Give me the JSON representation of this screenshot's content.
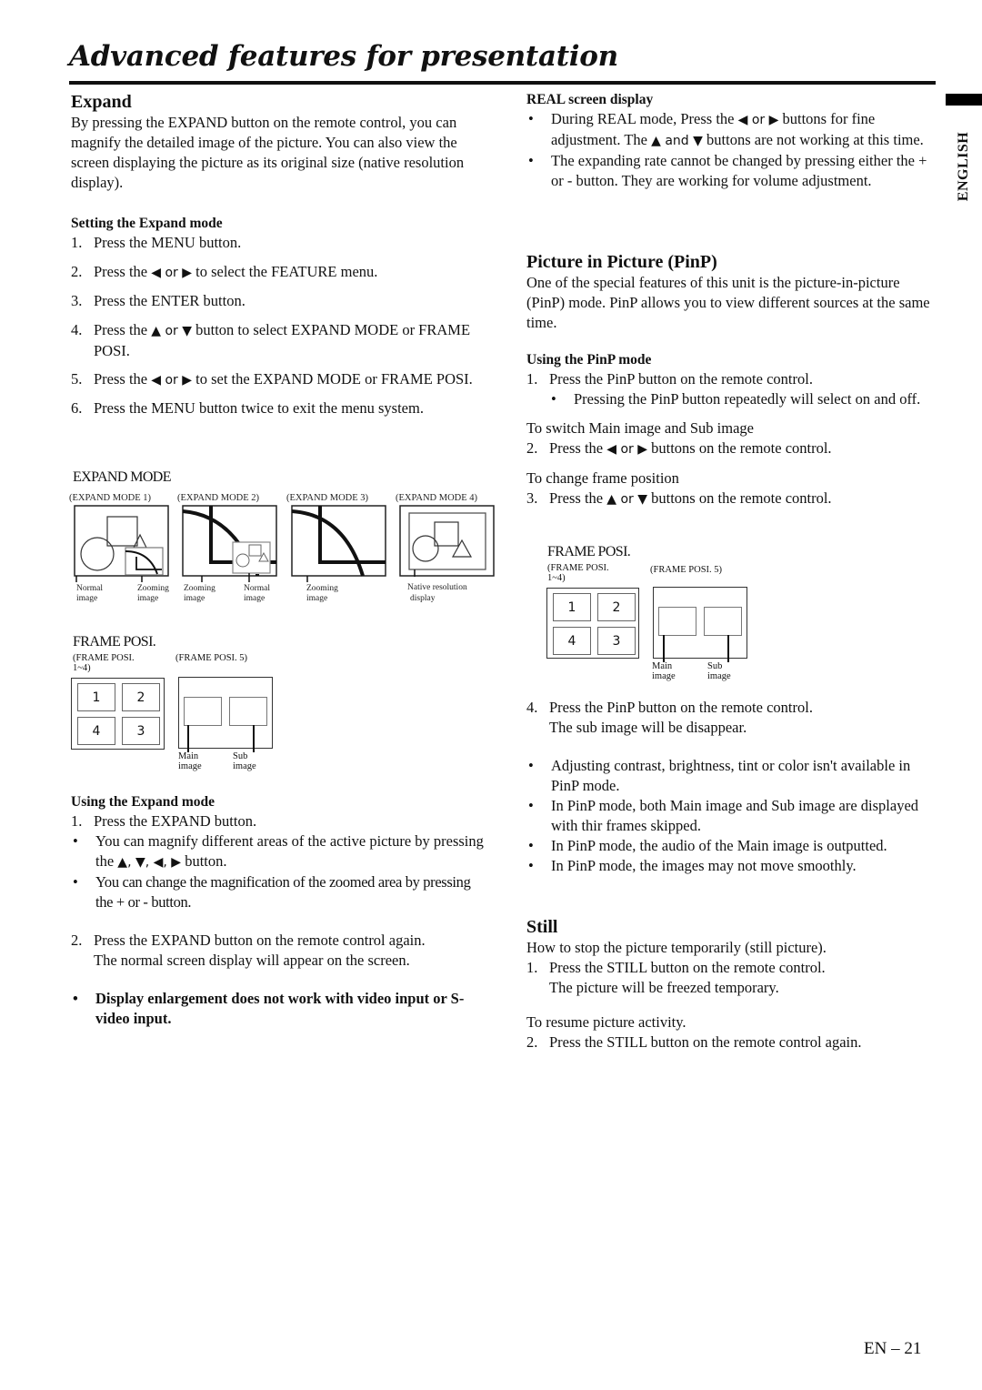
{
  "page": {
    "title": "Advanced features for presentation",
    "language_tab": "ENGLISH",
    "page_number": "EN – 21"
  },
  "expand": {
    "heading": "Expand",
    "intro": "By pressing the EXPAND button on the remote control, you can magnify the detailed image of the picture. You can also view the screen displaying the picture as its original size (native resolution display).",
    "setting": {
      "heading": "Setting the Expand mode",
      "steps": [
        {
          "n": "1.",
          "pre": "Press the MENU button.",
          "icons": "",
          "post": ""
        },
        {
          "n": "2.",
          "pre": "Press the ",
          "icons": "◀ or ▶",
          "post": " to select the FEATURE menu."
        },
        {
          "n": "3.",
          "pre": "Press the ENTER button.",
          "icons": "",
          "post": ""
        },
        {
          "n": "4.",
          "pre": "Press the ",
          "icons": "▲ or ▼",
          "post": " button to select EXPAND MODE or FRAME POSI."
        },
        {
          "n": "5.",
          "pre": "Press the ",
          "icons": "◀ or ▶",
          "post": " to set the EXPAND MODE or FRAME POSI."
        },
        {
          "n": "6.",
          "pre": "Press the MENU button twice to exit the menu system.",
          "icons": "",
          "post": ""
        }
      ]
    },
    "expand_mode_diagram": {
      "heading": "EXPAND MODE",
      "modes": [
        {
          "label": "(EXPAND MODE 1)",
          "callouts": [
            "Normal image",
            "Zooming image"
          ]
        },
        {
          "label": "(EXPAND MODE 2)",
          "callouts": [
            "Zooming image",
            "Normal image"
          ]
        },
        {
          "label": "(EXPAND MODE 3)",
          "callouts": [
            "Zooming image"
          ]
        },
        {
          "label": "(EXPAND MODE 4)",
          "callouts": [
            "Native resolution display"
          ]
        }
      ]
    },
    "frame_posi_diagram": {
      "heading": "FRAME POSI.",
      "label_1_4": "(FRAME POSI. 1~4)",
      "label_5": "(FRAME POSI. 5)",
      "cells": [
        "1",
        "2",
        "4",
        "3"
      ],
      "main_label": "Main image",
      "sub_label": "Sub image"
    },
    "using": {
      "heading": "Using the Expand mode",
      "step1": {
        "n": "1.",
        "text": "Press the EXPAND button."
      },
      "bullet1": {
        "pre": "You can magnify different areas of the active picture by pressing the ",
        "icons": "▲, ▼, ◀, ▶",
        "post": " button."
      },
      "bullet2": "You can change the magnification of the zoomed area by pressing the + or - button.",
      "step2": {
        "n": "2.",
        "text": "Press the EXPAND button on the remote control again.",
        "note": "The normal screen display will appear on the screen."
      },
      "warning": "Display enlargement does not work with video input or S-video input."
    }
  },
  "real_screen": {
    "heading": "REAL screen display",
    "bullet1": {
      "pre": "During REAL mode, Press the ",
      "icons1": "◀ or ▶",
      "mid": " buttons for fine adjustment. The ",
      "icons2": "▲ and ▼",
      "post": " buttons are not working at this time."
    },
    "bullet2": "The expanding rate cannot be changed by pressing either the + or - button. They are working for volume adjustment."
  },
  "pinp": {
    "heading": "Picture in Picture (PinP)",
    "intro": "One of the special features of this unit is the picture-in-picture (PinP) mode. PinP allows you to view different sources at the same time.",
    "using_heading": "Using the PinP mode",
    "step1": {
      "n": "1.",
      "text": "Press the PinP button on the remote control."
    },
    "step1_bullet": "Pressing the PinP button repeatedly will select on and off.",
    "switch_caption": "To switch Main image and Sub image",
    "step2": {
      "n": "2.",
      "pre": "Press the ",
      "icons": "◀ or ▶",
      "post": " buttons on the remote control."
    },
    "frame_caption": "To change frame position",
    "step3": {
      "n": "3.",
      "pre": "Press the ",
      "icons": "▲ or ▼",
      "post": " buttons on the remote control."
    },
    "frame_posi_diagram": {
      "heading": "FRAME POSI.",
      "label_1_4": "(FRAME POSI. 1~4)",
      "label_5": "(FRAME POSI. 5)",
      "cells": [
        "1",
        "2",
        "4",
        "3"
      ],
      "main_label": "Main image",
      "sub_label": "Sub image"
    },
    "step4": {
      "n": "4.",
      "text": "Press the PinP button on the remote control.",
      "note": "The sub image will be disappear."
    },
    "notes": [
      "Adjusting contrast, brightness, tint or color isn't available in PinP mode.",
      "In PinP mode, both Main image and Sub image are displayed with thir frames skipped.",
      "In PinP mode, the audio of the Main image is outputted.",
      "In PinP mode, the images may not move smoothly."
    ]
  },
  "still": {
    "heading": "Still",
    "intro": "How to stop the picture temporarily (still picture).",
    "step1": {
      "n": "1.",
      "text": "Press the STILL button on the remote control.",
      "note": "The picture will be freezed temporary."
    },
    "resume_caption": "To resume picture activity.",
    "step2": {
      "n": "2.",
      "text": "Press the STILL button on the remote control again."
    }
  }
}
